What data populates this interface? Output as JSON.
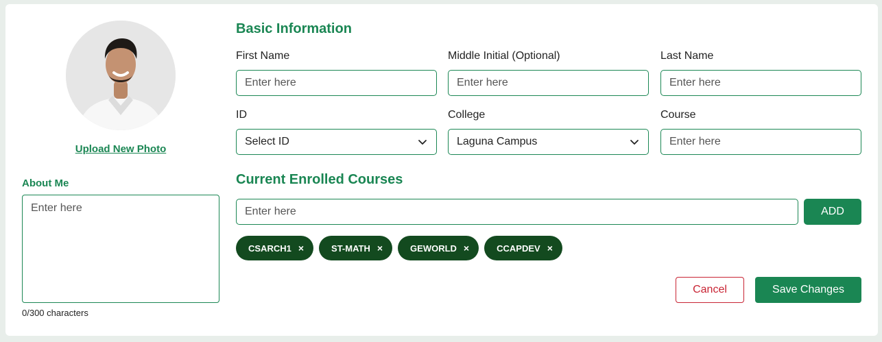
{
  "profile": {
    "upload_label": "Upload New Photo",
    "about_label": "About Me",
    "about_placeholder": "Enter here",
    "char_count": "0/300 characters"
  },
  "basic_info": {
    "title": "Basic Information",
    "first_name": {
      "label": "First Name",
      "placeholder": "Enter here"
    },
    "middle_initial": {
      "label": "Middle Initial (Optional)",
      "placeholder": "Enter here"
    },
    "last_name": {
      "label": "Last Name",
      "placeholder": "Enter here"
    },
    "id": {
      "label": "ID",
      "selected": "Select ID"
    },
    "college": {
      "label": "College",
      "selected": "Laguna Campus"
    },
    "course": {
      "label": "Course",
      "placeholder": "Enter here"
    }
  },
  "enrolled": {
    "title": "Current Enrolled Courses",
    "input_placeholder": "Enter here",
    "add_label": "ADD",
    "courses": [
      "CSARCH1",
      "ST-MATH",
      "GEWORLD",
      "CCAPDEV"
    ],
    "remove_glyph": "×"
  },
  "actions": {
    "cancel_label": "Cancel",
    "save_label": "Save Changes"
  },
  "colors": {
    "accent": "#1a8653",
    "chip": "#134a1f",
    "danger": "#c82333"
  },
  "icons": {
    "select_chevron": "chevron-down-icon",
    "chip_remove": "close-icon"
  }
}
